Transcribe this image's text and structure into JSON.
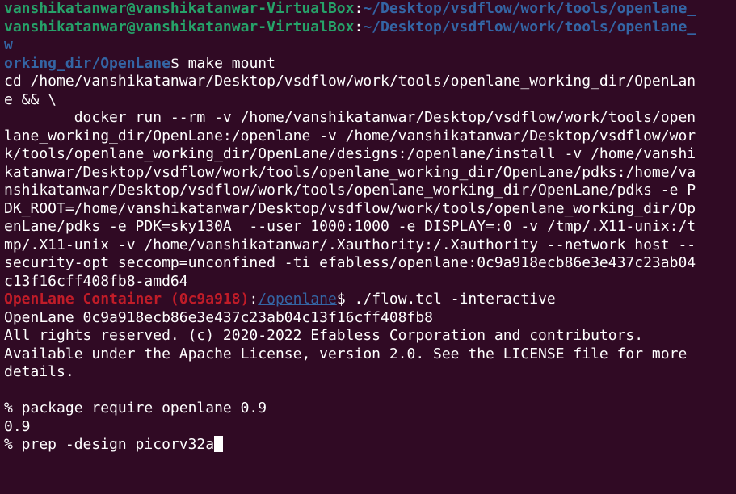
{
  "colors": {
    "background": "#300A24",
    "foreground": "#FFFFFF",
    "prompt_user": "#26A269",
    "prompt_path": "#3465A4",
    "container_prompt": "#C01C28"
  },
  "prompts": [
    {
      "user": "vanshikatanwar@vanshikatanwar-VirtualBox",
      "sep": ":",
      "path": "~/Desktop/vsdflow/work/tools/openlane_"
    },
    {
      "user": "vanshikatanwar@vanshikatanwar-VirtualBox",
      "sep": ":",
      "path": "~/Desktop/vsdflow/work/tools/openlane_"
    }
  ],
  "wrap_w": "w",
  "cmd_line": {
    "path": "orking_dir/OpenLane",
    "sign": "$ ",
    "cmd": "make mount"
  },
  "output1": [
    "cd /home/vanshikatanwar/Desktop/vsdflow/work/tools/openlane_working_dir/OpenLan",
    "e && \\",
    "        docker run --rm -v /home/vanshikatanwar/Desktop/vsdflow/work/tools/open",
    "lane_working_dir/OpenLane:/openlane -v /home/vanshikatanwar/Desktop/vsdflow/wor",
    "k/tools/openlane_working_dir/OpenLane/designs:/openlane/install -v /home/vanshi",
    "katanwar/Desktop/vsdflow/work/tools/openlane_working_dir/OpenLane/pdks:/home/va",
    "nshikatanwar/Desktop/vsdflow/work/tools/openlane_working_dir/OpenLane/pdks -e P",
    "DK_ROOT=/home/vanshikatanwar/Desktop/vsdflow/work/tools/openlane_working_dir/Op",
    "enLane/pdks -e PDK=sky130A  --user 1000:1000 -e DISPLAY=:0 -v /tmp/.X11-unix:/t",
    "mp/.X11-unix -v /home/vanshikatanwar/.Xauthority:/.Xauthority --network host --",
    "security-opt seccomp=unconfined -ti efabless/openlane:0c9a918ecb86e3e437c23ab04",
    "c13f16cff408fb8-amd64"
  ],
  "container_prompt": {
    "name": "OpenLane Container (0c9a918)",
    "colon": ":",
    "path": "/openlane",
    "sign": "$ ",
    "cmd": "./flow.tcl -interactive"
  },
  "output2": [
    "OpenLane 0c9a918ecb86e3e437c23ab04c13f16cff408fb8",
    "All rights reserved. (c) 2020-2022 Efabless Corporation and contributors.",
    "Available under the Apache License, version 2.0. See the LICENSE file for more",
    "details.",
    "",
    "% package require openlane 0.9",
    "0.9"
  ],
  "current_input": "% prep -design picorv32a"
}
